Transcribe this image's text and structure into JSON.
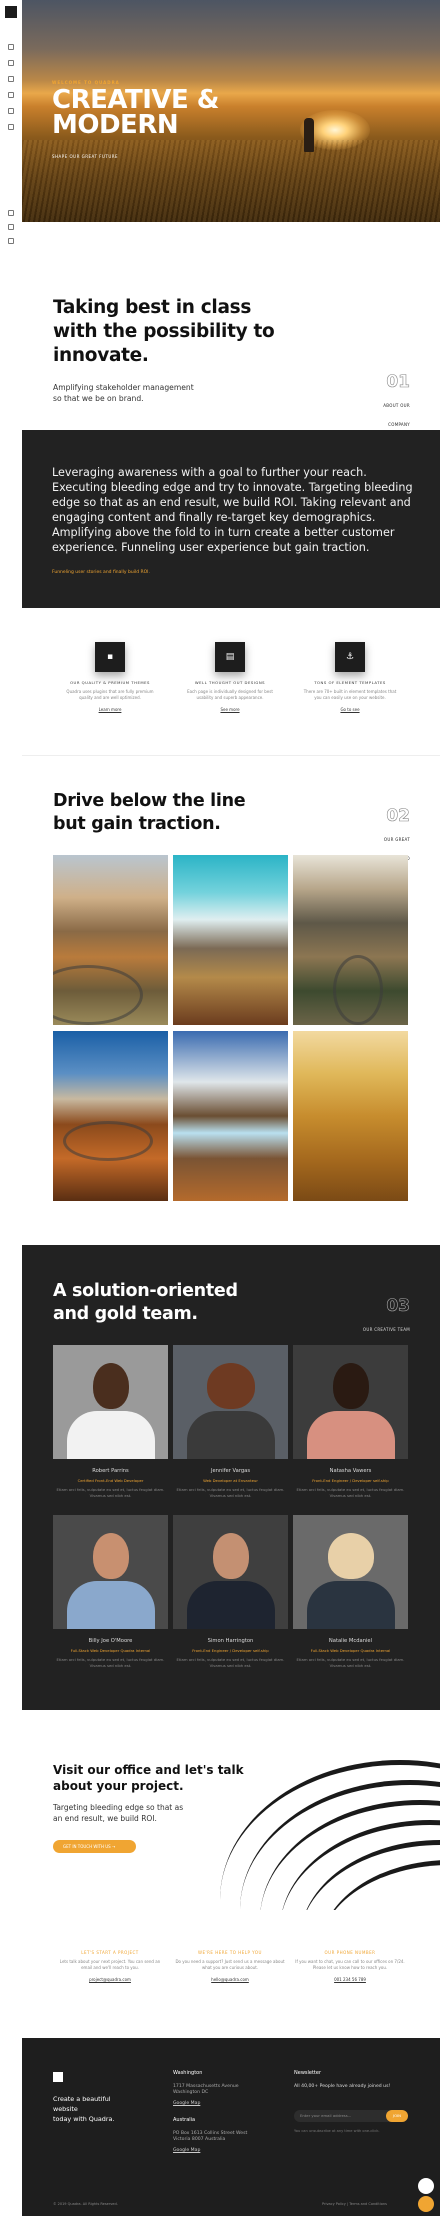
{
  "hero": {
    "eyebrow": "WELCOME TO QUADRA",
    "title_line1": "CREATIVE &",
    "title_line2": "MODERN",
    "subtitle": "SHAPE OUR GREAT FUTURE"
  },
  "intro": {
    "heading_line1": "Taking best in class",
    "heading_line2": "with the possibility to",
    "heading_line3": "innovate.",
    "text_line1": "Amplifying stakeholder management",
    "text_line2": "so that we be on brand.",
    "number": "01",
    "number_label": "ABOUT OUR COMPANY"
  },
  "statement": {
    "text": "Leveraging awareness with a goal to further your reach. Executing bleeding edge and try to innovate. Targeting bleeding edge so that as an end result, we build ROI. Taking relevant and engaging content and finally re-target key demographics. Amplifying above the fold to in turn create a better customer experience. Funneling user experience but gain traction.",
    "link": "Funneling user stories and finally build ROI."
  },
  "features": [
    {
      "icon": "box-icon",
      "glyph": "▪",
      "title": "OUR QUALITY & PREMIUM THEMES",
      "desc": "Quadra uses plugins that are fully premium quality and are well optimized.",
      "more": "Learn more"
    },
    {
      "icon": "document-icon",
      "glyph": "▤",
      "title": "WELL THOUGHT OUT DESIGNS",
      "desc": "Each page is individually designed for best usability and superb appearance.",
      "more": "See more"
    },
    {
      "icon": "anchor-icon",
      "glyph": "⚓",
      "title": "TONS OF ELEMENT TEMPLATES",
      "desc": "There are 70+ built in element templates that you can easily use on your website.",
      "more": "Go to see"
    }
  ],
  "portfolio": {
    "heading_line1": "Drive below the line",
    "heading_line2": "but gain traction.",
    "number": "02",
    "number_label": "OUR GREAT PORTFOLIO"
  },
  "team": {
    "heading_line1": "A solution-oriented",
    "heading_line2": "and gold team.",
    "number": "03",
    "number_label": "OUR CREATIVE TEAM",
    "members": [
      {
        "name": "Robert Parrins",
        "role": "Certified Front-End Web Developer",
        "desc": "Etiam orci felis, vulputate eu sed et, luctus feugiat diam. Vivamus sed nibh est."
      },
      {
        "name": "Jennifer Vargas",
        "role": "Web Developer at Envanteur",
        "desc": "Etiam orci felis, vulputate eu sed et, luctus feugiat diam. Vivamus sed nibh est."
      },
      {
        "name": "Natasha Vawers",
        "role": "Front-End Engineer / Developer self-ship",
        "desc": "Etiam orci felis, vulputate eu sed et, luctus feugiat diam. Vivamus sed nibh est."
      },
      {
        "name": "Billy Joe O'Moore",
        "role": "Full-Stack Web Developer Quadra Internal",
        "desc": "Etiam orci felis, vulputate eu sed et, luctus feugiat diam. Vivamus sed nibh est."
      },
      {
        "name": "Simon Harrington",
        "role": "Front-End Engineer / Developer self-ship",
        "desc": "Etiam orci felis, vulputate eu sed et, luctus feugiat diam. Vivamus sed nibh est."
      },
      {
        "name": "Natalie Mcdaniel",
        "role": "Full-Stack Web Developer Quadra Internal",
        "desc": "Etiam orci felis, vulputate eu sed et, luctus feugiat diam. Vivamus sed nibh est."
      }
    ]
  },
  "office": {
    "heading_line1": "Visit our office and let's talk",
    "heading_line2": "about your project.",
    "text_line1": "Targeting bleeding edge so that as",
    "text_line2": "an end result, we build ROI.",
    "button": "GET IN TOUCH WITH US  →"
  },
  "contacts": [
    {
      "title": "LET'S START A PROJECT",
      "desc": "Lets talk about your next project. You can send an email and we'll reach to you.",
      "link": "project@quadra.com"
    },
    {
      "title": "WE'RE HERE TO HELP YOU",
      "desc": "Do you need a support? Just send us a message about what you are curious about.",
      "link": "hello@quadra.com"
    },
    {
      "title": "OUR PHONE NUMBER",
      "desc": "If you want to chat, you can call to our offices on 7/24. Please let us know how to reach you.",
      "link": "001 234 56 789"
    }
  ],
  "footer": {
    "tagline_line1": "Create a beautiful website",
    "tagline_line2": "today with Quadra.",
    "col1_title": "Washington",
    "col1_lines": [
      "1717 Massachusetts Avenue",
      "Washington DC"
    ],
    "col1_link": "Google Map",
    "col2_title": "Australia",
    "col2_lines": [
      "PO Box 1613 Collins Street West",
      "Victoria 8007 Australia"
    ],
    "col2_link": "Google Map",
    "newsletter_title": "Newsletter",
    "newsletter_text": "All 40,00+ People have already joined us!",
    "newsletter_placeholder": "Enter your email address...",
    "newsletter_button": "JOIN",
    "newsletter_note": "You can unsubscribe at any time with one-click.",
    "copyright": "© 2019 Quadra. All Rights Reserved.",
    "links": "Privacy Policy  |  Terms and Conditions"
  },
  "colors": {
    "accent": "#f0a532",
    "dark": "#222222"
  }
}
